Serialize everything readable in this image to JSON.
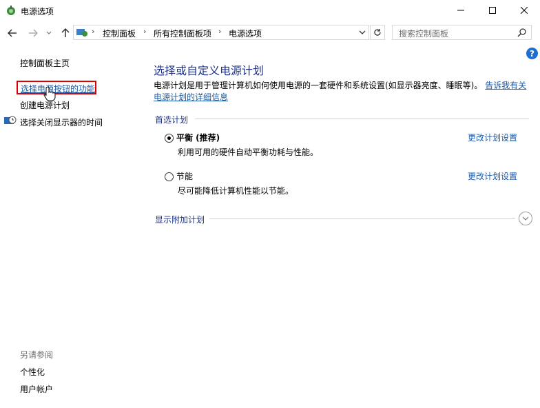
{
  "window": {
    "title": "电源选项"
  },
  "address": {
    "crumbs": [
      "控制面板",
      "所有控制面板项",
      "电源选项"
    ],
    "search_placeholder": "搜索控制面板"
  },
  "left": {
    "home": "控制面板主页",
    "links": [
      "选择电源按钮的功能",
      "创建电源计划",
      "选择关闭显示器的时间"
    ],
    "see_also_title": "另请参阅",
    "see_also": [
      "个性化",
      "用户帐户"
    ]
  },
  "main": {
    "title": "选择或自定义电源计划",
    "desc_text": "电源计划是用于管理计算机如何使用电源的一套硬件和系统设置(如显示器亮度、睡眠等)。",
    "desc_link": "告诉我有关电源计划的详细信息",
    "preferred_title": "首选计划",
    "plans": [
      {
        "name": "平衡 (推荐)",
        "desc": "利用可用的硬件自动平衡功耗与性能。",
        "link": "更改计划设置",
        "selected": true
      },
      {
        "name": "节能",
        "desc": "尽可能降低计算机性能以节能。",
        "link": "更改计划设置",
        "selected": false
      }
    ],
    "additional_title": "显示附加计划"
  },
  "colors": {
    "link": "#1a5aa8",
    "heading": "#1e3287",
    "highlight": "#e00000",
    "help": "#1f6fd1"
  },
  "icons": [
    "power-options-icon",
    "minimize-icon",
    "maximize-icon",
    "close-icon",
    "back-arrow-icon",
    "forward-arrow-icon",
    "history-dropdown-icon",
    "up-arrow-icon",
    "control-panel-icon",
    "address-dropdown-icon",
    "refresh-icon",
    "search-icon",
    "help-icon",
    "display-clock-icon",
    "expand-chevron-icon",
    "mouse-cursor-icon"
  ]
}
